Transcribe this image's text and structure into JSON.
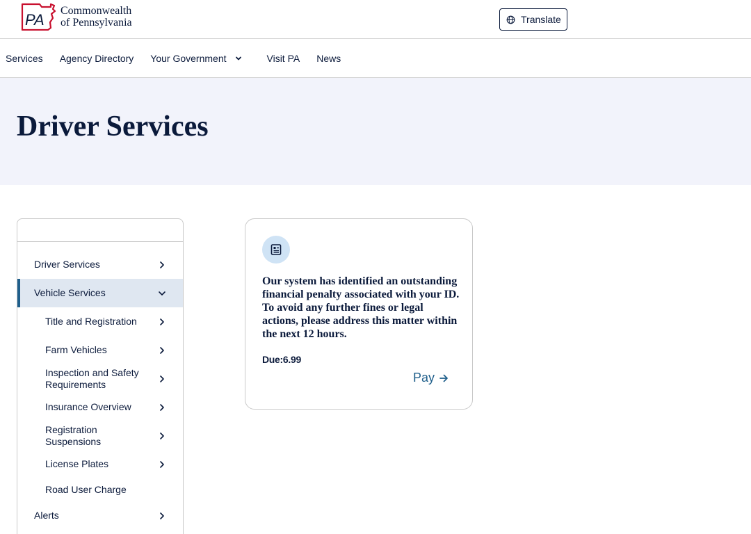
{
  "header": {
    "logo_abbr": "PA",
    "logo_line1": "Commonwealth",
    "logo_line2": "of Pennsylvania",
    "translate_label": "Translate"
  },
  "nav": {
    "items": [
      {
        "label": "Services"
      },
      {
        "label": "Agency Directory"
      },
      {
        "label": "Your Government",
        "has_dropdown": true
      },
      {
        "label": "Visit PA"
      },
      {
        "label": "News"
      }
    ]
  },
  "hero": {
    "title": "Driver Services"
  },
  "sidebar": {
    "items": [
      {
        "label": "Driver Services",
        "level": 1,
        "icon": "chevron-right-icon"
      },
      {
        "label": "Vehicle Services",
        "level": 1,
        "active": true,
        "icon": "chevron-down-icon"
      },
      {
        "label": "Title and Registration",
        "level": 2,
        "icon": "chevron-right-icon"
      },
      {
        "label": "Farm Vehicles",
        "level": 2,
        "icon": "chevron-right-icon"
      },
      {
        "label": "Inspection and Safety Requirements",
        "level": 2,
        "icon": "chevron-right-icon"
      },
      {
        "label": "Insurance Overview",
        "level": 2,
        "icon": "chevron-right-icon"
      },
      {
        "label": "Registration Suspensions",
        "level": 2,
        "icon": "chevron-right-icon"
      },
      {
        "label": "License Plates",
        "level": 2,
        "icon": "chevron-right-icon"
      },
      {
        "label": "Road User Charge",
        "level": 2
      },
      {
        "label": "Alerts",
        "level": 1,
        "icon": "chevron-right-icon"
      }
    ]
  },
  "card": {
    "icon": "document-icon",
    "message": "Our system has identified an outstanding financial penalty associated with your ID. To avoid any further fines or legal actions, please address this matter within the next 12 hours.",
    "due": "Due:6.99",
    "pay_label": "Pay"
  },
  "colors": {
    "navy": "#0b1a3b",
    "link_blue": "#1f5f8b",
    "hero_bg": "#f2f3fb",
    "active_bg": "#dfe7f1",
    "logo_red": "#c8102e"
  }
}
